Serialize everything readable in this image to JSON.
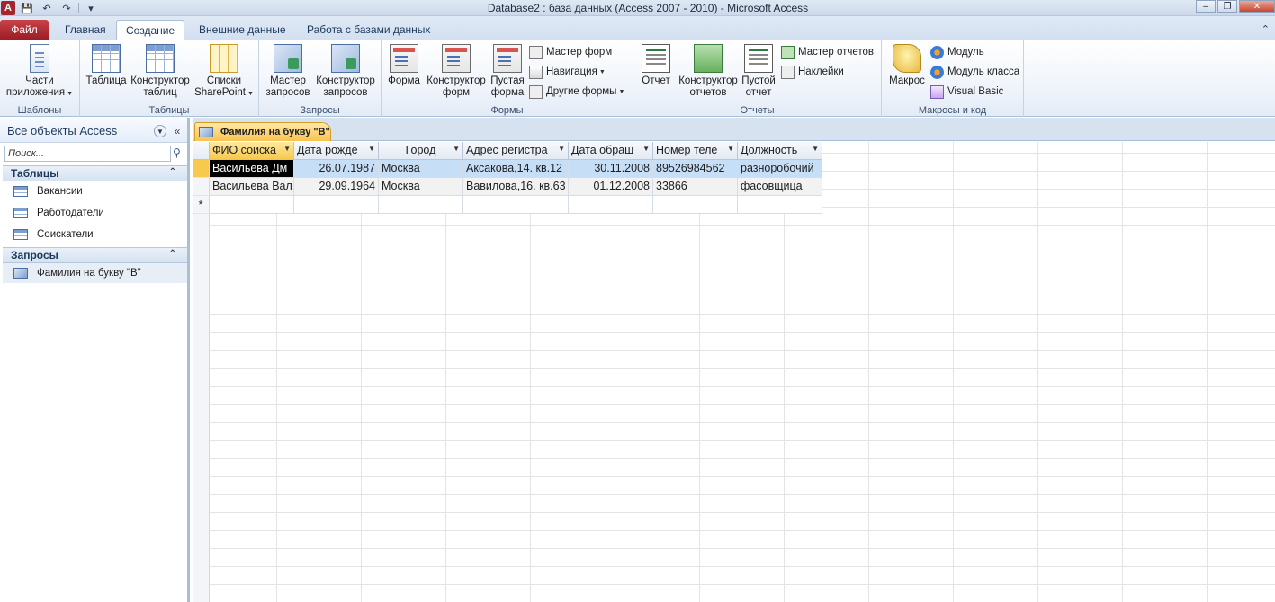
{
  "window": {
    "title": "Database2 : база данных (Access 2007 - 2010)  -  Microsoft Access",
    "app_letter": "A"
  },
  "ribbon_tabs": [
    {
      "label": "Файл"
    },
    {
      "label": "Главная"
    },
    {
      "label": "Создание"
    },
    {
      "label": "Внешние данные"
    },
    {
      "label": "Работа с базами данных"
    }
  ],
  "ribbon": {
    "groups": {
      "templates": "Шаблоны",
      "tables": "Таблицы",
      "queries": "Запросы",
      "forms": "Формы",
      "reports": "Отчеты",
      "macros": "Макросы и код"
    },
    "app_parts": "Части\nприложения",
    "table": "Таблица",
    "table_design": "Конструктор\nтаблиц",
    "sharepoint_lists": "Списки\nSharePoint",
    "query_wizard": "Мастер\nзапросов",
    "query_design": "Конструктор\nзапросов",
    "form": "Форма",
    "form_design": "Конструктор\nформ",
    "blank_form": "Пустая\nформа",
    "form_wizard": "Мастер форм",
    "navigation": "Навигация",
    "more_forms": "Другие формы",
    "report": "Отчет",
    "report_design": "Конструктор\nотчетов",
    "blank_report": "Пустой\nотчет",
    "report_wizard": "Мастер отчетов",
    "labels": "Наклейки",
    "macro": "Макрос",
    "module": "Модуль",
    "class_module": "Модуль класса",
    "visual_basic": "Visual Basic"
  },
  "nav_pane": {
    "title": "Все объекты Access",
    "search_placeholder": "Поиск...",
    "tables_header": "Таблицы",
    "tables": [
      "Вакансии",
      "Работодатели",
      "Соискатели"
    ],
    "queries_header": "Запросы",
    "queries": [
      "Фамилия на букву \"В\""
    ]
  },
  "document": {
    "tab_label": "Фамилия на букву \"В\"",
    "columns": [
      "ФИО соиска",
      "Дата рожде",
      "Город",
      "Адрес регистра",
      "Дата обраш",
      "Номер теле",
      "Должность"
    ],
    "rows": [
      [
        "Васильева Дм",
        "26.07.1987",
        "Москва",
        "Аксакова,14. кв.12",
        "30.11.2008",
        "89526984562",
        "разноробочий"
      ],
      [
        "Васильева Вал",
        "29.09.1964",
        "Москва",
        "Вавилова,16. кв.63",
        "01.12.2008",
        "33866",
        "фасовщица"
      ]
    ],
    "new_row_marker": "*"
  }
}
